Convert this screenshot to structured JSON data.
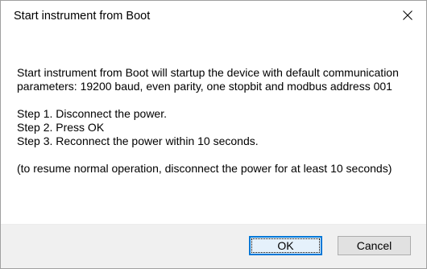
{
  "window": {
    "title": "Start instrument from Boot"
  },
  "icons": {
    "close": "close-icon"
  },
  "message": {
    "intro": "Start instrument from Boot will startup the device with default communication parameters: 19200 baud, even parity, one stopbit and modbus address 001",
    "steps": [
      "Step 1. Disconnect the power.",
      "Step 2. Press OK",
      "Step 3. Reconnect the power within 10 seconds."
    ],
    "note": "(to resume normal operation, disconnect the power for at least 10 seconds)"
  },
  "buttons": {
    "ok_label": "OK",
    "cancel_label": "Cancel"
  },
  "colors": {
    "default_button_border": "#0078d7",
    "footer_background": "#f0f0f0"
  }
}
